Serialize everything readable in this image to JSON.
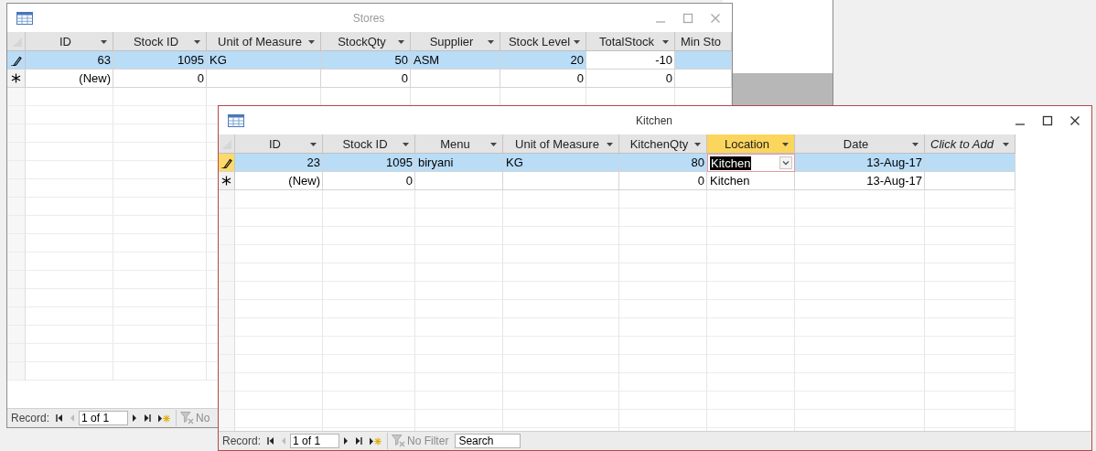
{
  "windows": [
    {
      "title": "Stores",
      "active": false,
      "columns": [
        {
          "label": "ID",
          "kind": "number",
          "selected": false,
          "focused": false
        },
        {
          "label": "Stock ID",
          "kind": "number",
          "selected": false,
          "focused": false
        },
        {
          "label": "Unit of Measure",
          "kind": "text",
          "selected": false,
          "focused": false
        },
        {
          "label": "StockQty",
          "kind": "number",
          "selected": false,
          "focused": false
        },
        {
          "label": "Supplier",
          "kind": "text",
          "selected": false,
          "focused": false
        },
        {
          "label": "Stock Level",
          "kind": "number",
          "selected": false,
          "focused": false
        },
        {
          "label": "TotalStock",
          "kind": "number",
          "selected": false,
          "focused": true
        },
        {
          "label": "Min Sto",
          "kind": "number",
          "selected": false,
          "focused": false
        }
      ],
      "rows": [
        {
          "kind": "edit",
          "selected": true,
          "cells": [
            "63",
            "1095",
            "KG",
            "50",
            "ASM",
            "20",
            "-10",
            null
          ]
        },
        {
          "kind": "new",
          "selected": false,
          "cells": [
            "(New)",
            "0",
            null,
            "0",
            null,
            "0",
            "0",
            null
          ]
        }
      ],
      "navigation": {
        "label": "Record:",
        "position": "1 of 1",
        "filter": "No"
      }
    },
    {
      "title": "Kitchen",
      "active": true,
      "columns": [
        {
          "label": "ID",
          "kind": "number",
          "selected": false,
          "focused": false
        },
        {
          "label": "Stock ID",
          "kind": "number",
          "selected": false,
          "focused": false
        },
        {
          "label": "Menu",
          "kind": "text",
          "selected": false,
          "focused": false
        },
        {
          "label": "Unit of Measure",
          "kind": "text",
          "selected": false,
          "focused": false
        },
        {
          "label": "KitchenQty",
          "kind": "number",
          "selected": false,
          "focused": false
        },
        {
          "label": "Location",
          "kind": "lookup",
          "selected": true,
          "focused": true
        },
        {
          "label": "Date",
          "kind": "date",
          "selected": false,
          "focused": false
        },
        {
          "label": "Click to Add",
          "kind": "add",
          "selected": false,
          "focused": false
        }
      ],
      "rows": [
        {
          "kind": "edit",
          "selected": true,
          "cells": [
            "23",
            "1095",
            "biryani",
            "KG",
            "80",
            "Kitchen",
            "13-Aug-17",
            null
          ]
        },
        {
          "kind": "new",
          "selected": false,
          "cells": [
            "(New)",
            "0",
            null,
            null,
            "0",
            "Kitchen",
            "13-Aug-17",
            null
          ]
        }
      ],
      "navigation": {
        "label": "Record:",
        "position": "1 of 1",
        "filter": "No Filter",
        "search_placeholder": "Search"
      }
    }
  ]
}
